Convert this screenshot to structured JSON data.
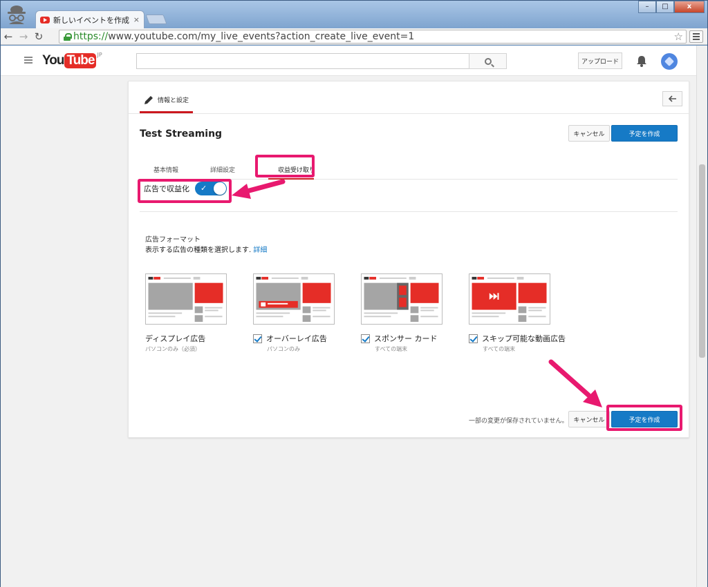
{
  "browser": {
    "tab_title": "新しいイベントを作成 - Y",
    "tab_close": "×",
    "url_scheme": "https://",
    "url_rest": "www.youtube.com/my_live_events?action_create_live_event=1",
    "window_buttons": [
      "–",
      "□",
      "x"
    ]
  },
  "youtube": {
    "logo_you": "You",
    "logo_tube": "Tube",
    "logo_region": "JP",
    "search_placeholder": "",
    "upload_label": "アップロード"
  },
  "card": {
    "tab_label": "情報と設定",
    "event_title": "Test Streaming",
    "cancel_label": "キャンセル",
    "create_label": "予定を作成",
    "subtabs": [
      "基本情報",
      "詳細設定",
      "収益受け取り"
    ],
    "monetize_label": "広告で収益化",
    "monetize_on": true,
    "format_title": "広告フォーマット",
    "format_desc": "表示する広告の種類を選択します.",
    "format_link": "詳細",
    "unsaved_text": "一部の変更が保存されていません。",
    "ads": [
      {
        "name": "ディスプレイ広告",
        "sub": "パソコンのみ（必須）",
        "checkbox": false
      },
      {
        "name": "オーバーレイ広告",
        "sub": "パソコンのみ",
        "checkbox": true,
        "checked": true
      },
      {
        "name": "スポンサー カード",
        "sub": "すべての端末",
        "checkbox": true,
        "checked": true
      },
      {
        "name": "スキップ可能な動画広告",
        "sub": "すべての端末",
        "checkbox": true,
        "checked": true
      }
    ]
  },
  "colors": {
    "accent": "#167ac6",
    "brand_red": "#e52d27",
    "highlight": "#e8196f"
  }
}
